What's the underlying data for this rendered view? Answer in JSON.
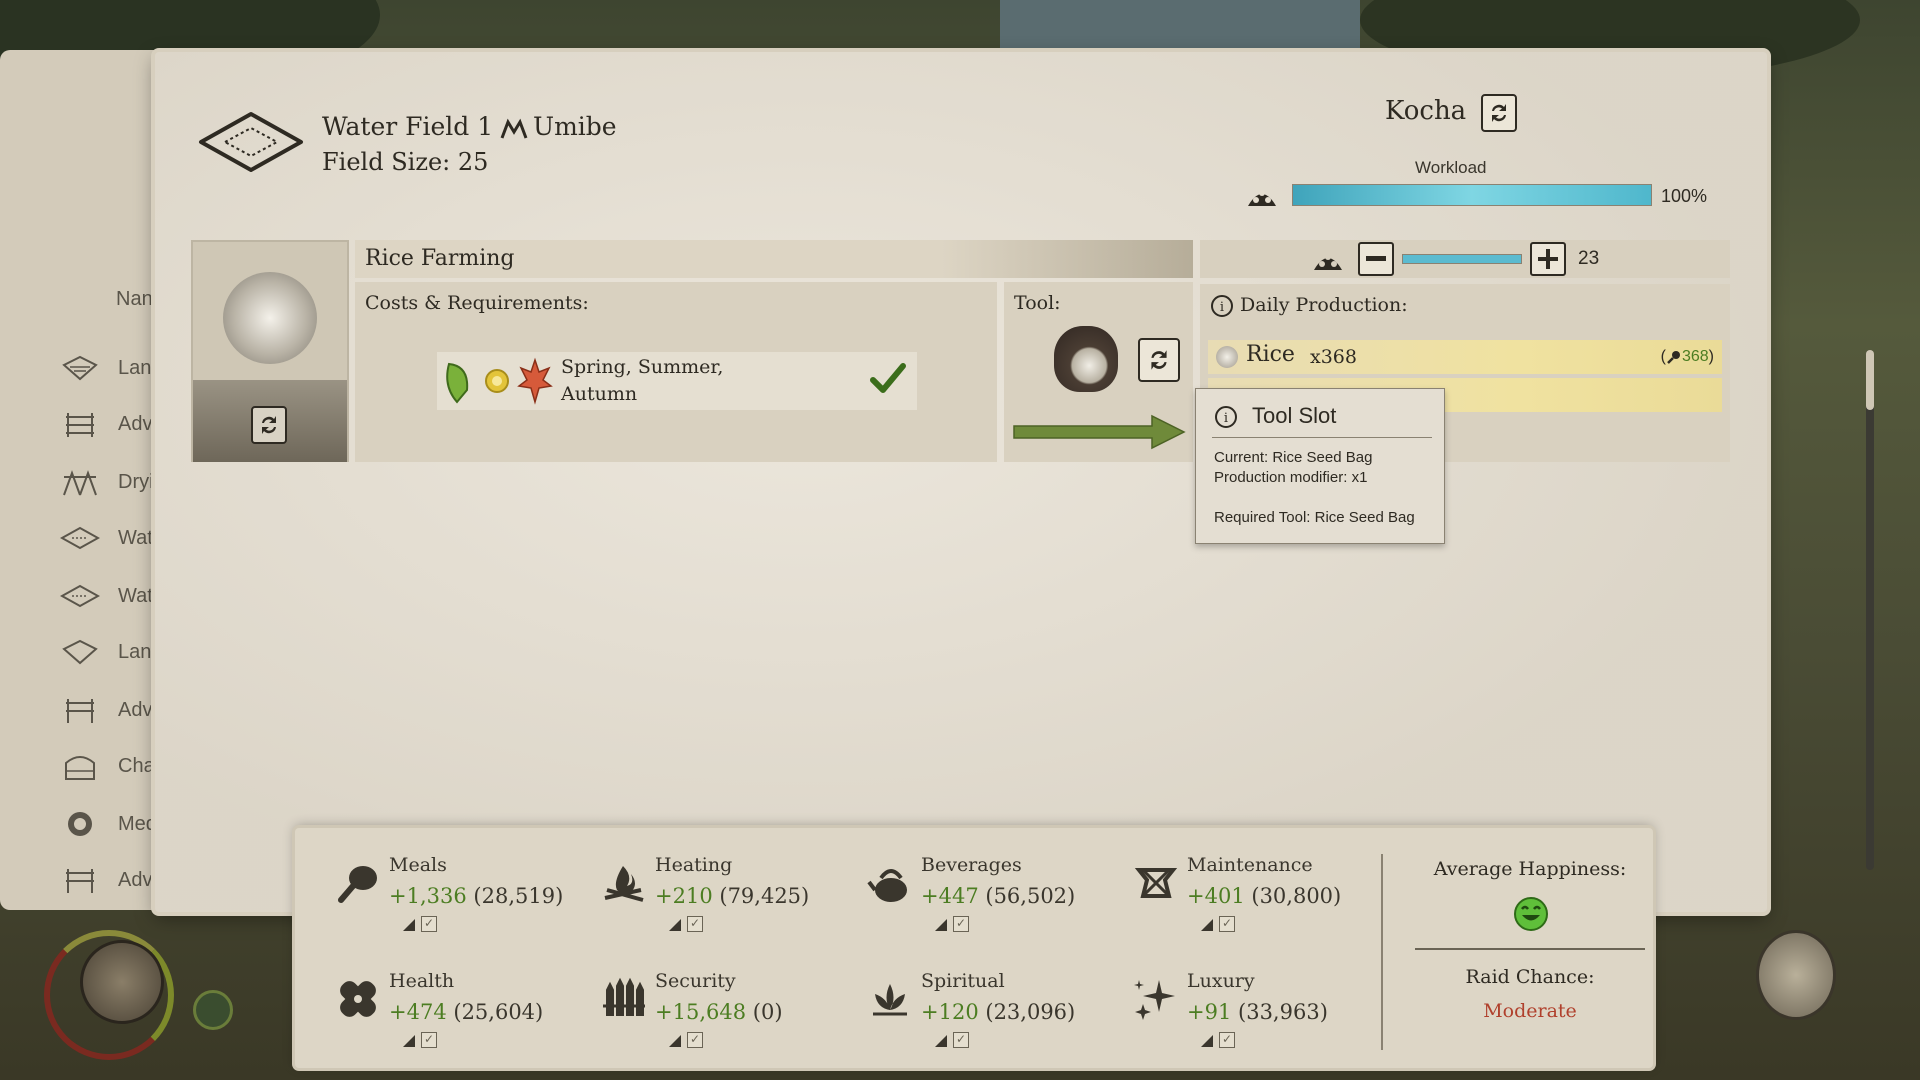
{
  "field": {
    "title": "Water Field 1",
    "region": "Umibe",
    "size": "Field Size: 25"
  },
  "worker": {
    "name": "Kocha"
  },
  "workload": {
    "label": "Workload",
    "value": "100%",
    "fraction": 1.0
  },
  "workers": {
    "count": "23",
    "fraction": 1.0
  },
  "recipe": {
    "name": "Rice Farming",
    "costs_label": "Costs & Requirements:",
    "seasons": "Spring, Summer, Autumn",
    "tool_label": "Tool:"
  },
  "production": {
    "label": "Daily Production:",
    "item": "Rice",
    "amount": "x368",
    "stock": "368"
  },
  "tooltip": {
    "title": "Tool Slot",
    "current": "Current: Rice Seed Bag",
    "modifier": "Production modifier: x1",
    "required": "Required Tool: Rice Seed Bag"
  },
  "left_list": [
    "Lan",
    "Adv",
    "Dryi",
    "Wate",
    "Wat",
    "Lan",
    "Adv",
    "Cha",
    "Med",
    "Adv"
  ],
  "left_header": "Nan",
  "stats": [
    {
      "name": "Meals",
      "delta": "+1,336",
      "total": "(28,519)",
      "icon": "meat-icon"
    },
    {
      "name": "Heating",
      "delta": "+210",
      "total": "(79,425)",
      "icon": "campfire-icon"
    },
    {
      "name": "Beverages",
      "delta": "+447",
      "total": "(56,502)",
      "icon": "kettle-icon"
    },
    {
      "name": "Maintenance",
      "delta": "+401",
      "total": "(30,800)",
      "icon": "anvil-icon"
    },
    {
      "name": "Health",
      "delta": "+474",
      "total": "(25,604)",
      "icon": "bandage-icon"
    },
    {
      "name": "Security",
      "delta": "+15,648",
      "total": "(0)",
      "icon": "palisade-icon"
    },
    {
      "name": "Spiritual",
      "delta": "+120",
      "total": "(23,096)",
      "icon": "lotus-icon"
    },
    {
      "name": "Luxury",
      "delta": "+91",
      "total": "(33,963)",
      "icon": "sparkle-icon"
    }
  ],
  "happiness": {
    "label": "Average Happiness:",
    "mood": "happy-face-icon"
  },
  "raid": {
    "label": "Raid Chance:",
    "value": "Moderate"
  },
  "colors": {
    "positive": "#4c7d22",
    "raid": "#b0402c",
    "workload_bar": "#4fb7cc",
    "highlight": "#f0e2a0"
  }
}
